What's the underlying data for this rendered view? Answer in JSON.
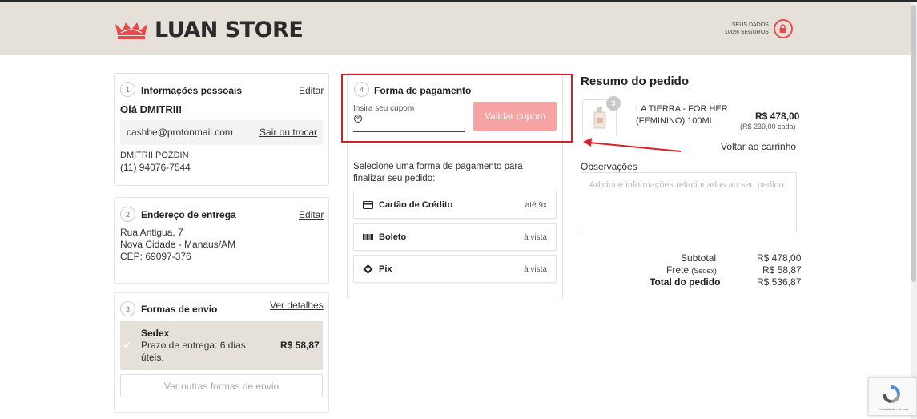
{
  "header": {
    "brand": "LUAN STORE",
    "secure_line1": "SEUS DADOS",
    "secure_line2": "100% SEGUROS"
  },
  "personal": {
    "step": "1",
    "title": "Informações pessoais",
    "edit": "Editar",
    "greeting": "Olá DMITRII!",
    "email": "cashbe@protonmail.com",
    "switch": "Sair ou trocar",
    "name": "DMITRII POZDIN",
    "phone": "(11) 94076-7544"
  },
  "address": {
    "step": "2",
    "title": "Endereço de entrega",
    "edit": "Editar",
    "street": "Rua Antigua, 7",
    "city": "Nova Cidade - Manaus/AM",
    "cep": "CEP: 69097-376"
  },
  "shipping": {
    "step": "3",
    "title": "Formas de envio",
    "details": "Ver detalhes",
    "method": "Sedex",
    "eta_line1": "Prazo de entrega: 6 dias",
    "eta_line2": "úteis.",
    "price": "R$ 58,87",
    "other": "Ver outras formas de envio"
  },
  "payment": {
    "step": "4",
    "title": "Forma de pagamento",
    "coupon_label": "Insira seu cupom",
    "validate": "Validar cupom",
    "select_line1": "Selecione uma forma de pagamento para",
    "select_line2": "finalizar seu pedido:",
    "options": [
      {
        "label": "Cartão de Crédito",
        "right": "até 9x",
        "icon": "credit-card-icon"
      },
      {
        "label": "Boleto",
        "right": "à vista",
        "icon": "barcode-icon"
      },
      {
        "label": "Pix",
        "right": "à vista",
        "icon": "pix-icon"
      }
    ]
  },
  "summary": {
    "title": "Resumo do pedido",
    "qty": "3",
    "product_line1": "LA TIERRA - FOR HER",
    "product_line2": "(FEMININO) 100ML",
    "product_price": "R$ 478,00",
    "product_unit": "(R$ 239,00 cada)",
    "back": "Voltar ao carrinho",
    "obs_label": "Observações",
    "obs_placeholder": "Adicione informações relacionadas ao seu pedido",
    "subtotal_label": "Subtotal",
    "subtotal": "R$ 478,00",
    "frete_label": "Frete",
    "frete_note": "(Sedex)",
    "frete": "R$ 58,87",
    "total_label": "Total do pedido",
    "total": "R$ 536,87"
  },
  "recaptcha": {
    "text": "Privacidade - Termos"
  },
  "colors": {
    "accent": "#e84a4a",
    "beige": "#e6e1d8",
    "highlight": "#d8202a",
    "button": "#f5a3a3"
  }
}
